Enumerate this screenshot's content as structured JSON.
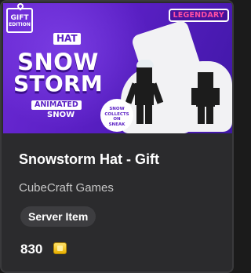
{
  "banner": {
    "gift_badge_line1": "GIFT",
    "gift_badge_line2": "EDITION",
    "rarity": "LEGENDARY",
    "hat_tag": "HAT",
    "title_line1": "SNOW",
    "title_line2": "STORM",
    "animated_tag": "ANIMATED",
    "animated_sub": "SNOW",
    "bubble_l1": "SNOW",
    "bubble_l2": "COLLECTS",
    "bubble_l3": "ON",
    "bubble_l4": "SNEAK"
  },
  "item": {
    "title": "Snowstorm Hat - Gift",
    "publisher": "CubeCraft Games",
    "badge": "Server Item",
    "price": "830",
    "currency_icon": "minecoin-icon"
  },
  "colors": {
    "banner_purple": "#5a1fc4",
    "legendary_pink": "#ff4fa3",
    "card_bg": "#2b2b2d"
  }
}
